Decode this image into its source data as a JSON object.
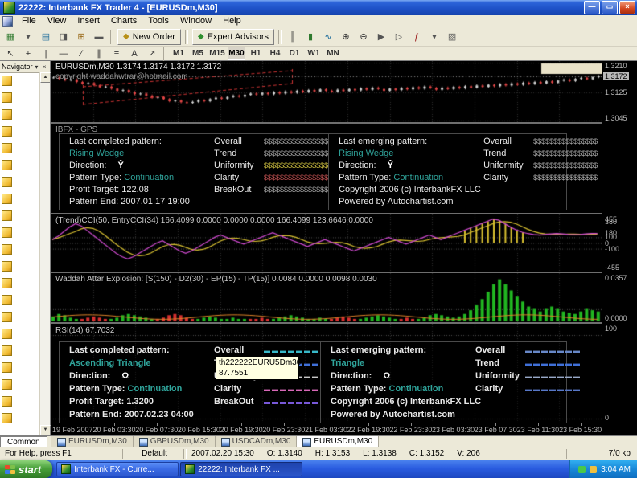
{
  "window": {
    "title": "22222: Interbank FX Trader 4 - [EURUSDm,M30]",
    "buttons": [
      {
        "name": "minimize-button",
        "glyph": "—"
      },
      {
        "name": "restore-button",
        "glyph": "▭"
      },
      {
        "name": "close-button",
        "glyph": "×"
      }
    ]
  },
  "menu": {
    "items": [
      "File",
      "View",
      "Insert",
      "Charts",
      "Tools",
      "Window",
      "Help"
    ]
  },
  "toolbar1": {
    "icons_a": [
      {
        "name": "new-chart-icon",
        "glyph": "▦",
        "color": "#2f7a2f"
      },
      {
        "name": "profiles-icon",
        "glyph": "▾",
        "color": "#555555"
      },
      {
        "name": "market-watch-icon",
        "glyph": "▤",
        "color": "#1a6a9a"
      },
      {
        "name": "data-window-icon",
        "glyph": "◨",
        "color": "#555555"
      },
      {
        "name": "navigator-icon",
        "glyph": "⊞",
        "color": "#9a6a1a"
      },
      {
        "name": "terminal-icon",
        "glyph": "▬",
        "color": "#555555"
      }
    ],
    "new_order": {
      "label": "New Order",
      "icon_glyph": "◆",
      "icon_color": "#b89018"
    },
    "expert_advisors": {
      "label": "Expert Advisors",
      "icon_glyph": "◆",
      "icon_color": "#2f8f2f"
    },
    "icons_b": [
      {
        "name": "bar-chart-icon",
        "glyph": "║",
        "color": "#333333"
      },
      {
        "name": "candlestick-icon",
        "glyph": "▮",
        "color": "#2f7a2f"
      },
      {
        "name": "line-chart-icon",
        "glyph": "∿",
        "color": "#1a6a9a"
      },
      {
        "name": "zoom-in-icon",
        "glyph": "⊕",
        "color": "#333333"
      },
      {
        "name": "zoom-out-icon",
        "glyph": "⊖",
        "color": "#333333"
      },
      {
        "name": "auto-scroll-icon",
        "glyph": "▶",
        "color": "#555555"
      },
      {
        "name": "chart-shift-icon",
        "glyph": "▷",
        "color": "#555555"
      },
      {
        "name": "indicators-icon",
        "glyph": "ƒ",
        "color": "#9a1a1a"
      },
      {
        "name": "periods-icon",
        "glyph": "▾",
        "color": "#555555"
      },
      {
        "name": "templates-icon",
        "glyph": "▧",
        "color": "#555555"
      }
    ]
  },
  "toolbar2": {
    "tools": [
      {
        "name": "cursor-icon",
        "glyph": "↖"
      },
      {
        "name": "crosshair-icon",
        "glyph": "+"
      },
      {
        "name": "vertical-line-icon",
        "glyph": "|"
      },
      {
        "name": "horizontal-line-icon",
        "glyph": "—"
      },
      {
        "name": "trendline-icon",
        "glyph": "∕"
      },
      {
        "name": "channel-icon",
        "glyph": "∥"
      },
      {
        "name": "fibonacci-icon",
        "glyph": "≡"
      },
      {
        "name": "text-icon",
        "glyph": "A"
      },
      {
        "name": "arrows-icon",
        "glyph": "↗"
      }
    ],
    "timeframes": [
      {
        "label": "M1",
        "active": false
      },
      {
        "label": "M5",
        "active": false
      },
      {
        "label": "M15",
        "active": false
      },
      {
        "label": "M30",
        "active": true
      },
      {
        "label": "H1",
        "active": false
      },
      {
        "label": "H4",
        "active": false
      },
      {
        "label": "D1",
        "active": false
      },
      {
        "label": "W1",
        "active": false
      },
      {
        "label": "MN",
        "active": false
      }
    ]
  },
  "navigator": {
    "title": "Navigator",
    "icon_count": 21,
    "common_tab": "Common"
  },
  "chart": {
    "info_line": "EURUSDm,M30 1.3174 1.3174 1.3172 1.3172",
    "copyright_line": "copyright waddahwtrar@hotmail.com"
  },
  "gps": {
    "panel_label": "IBFX - GPS",
    "left": {
      "header": "Last completed pattern:",
      "pattern": "Rising Wedge",
      "direction_label": "Direction:",
      "direction_symbol": "Ŷ",
      "type_label": "Pattern Type:",
      "type_value": "Continuation",
      "target_label": "Profit Target:",
      "target_value": "122.08",
      "end_label": "Pattern End:",
      "end_value": "2007.01.17 19:00"
    },
    "left_ratings": [
      {
        "label": "Overall",
        "value": "$$$$$$$$$$$$$$$$",
        "color": "#a8a8a8"
      },
      {
        "label": "Trend",
        "value": "$$$$$$$$$$$$$$$$",
        "color": "#a8a8a8"
      },
      {
        "label": "Uniformity",
        "value": "$$$$$$$$$$$$$$$$",
        "color": "#cfc040"
      },
      {
        "label": "Clarity",
        "value": "$$$$$$$$$$$$$$$$",
        "color": "#c05050"
      },
      {
        "label": "BreakOut",
        "value": "$$$$$$$$$$$$$$$$",
        "color": "#a8a8a8"
      }
    ],
    "right": {
      "header": "Last emerging pattern:",
      "pattern": "Rising Wedge",
      "direction_label": "Direction:",
      "direction_symbol": "Ŷ",
      "type_label": "Pattern Type:",
      "type_value": "Continuation"
    },
    "right_ratings": [
      {
        "label": "Overall",
        "value": "$$$$$$$$$$$$$$$$",
        "color": "#a8a8a8"
      },
      {
        "label": "Trend",
        "value": "$$$$$$$$$$$$$$$$",
        "color": "#a8a8a8"
      },
      {
        "label": "Uniformity",
        "value": "$$$$$$$$$$$$$$$$",
        "color": "#a8a8a8"
      },
      {
        "label": "Clarity",
        "value": "$$$$$$$$$$$$$$$$",
        "color": "#a8a8a8"
      }
    ],
    "copyright1": "Copyright 2006 (c) InterbankFX LLC",
    "copyright2": "Powered by Autochartist.com"
  },
  "cci": {
    "label": "(Trend)CCI(50, EntryCCI(34) 166.4099 0.0000 0.0000 0.0000 166.4099 123.6646 0.0000"
  },
  "waddah": {
    "label": "Waddah Attar Explosion: [S(150) - D2(30) - EP(15) - TP(15)] 0.0084 0.0000 0.0098 0.0030"
  },
  "rsi": {
    "label": "RSI(14) 67.7032",
    "left": {
      "header": "Last completed pattern:",
      "pattern": "Ascending Triangle",
      "direction_label": "Direction:",
      "direction_symbol": "Ω",
      "type_label": "Pattern Type:",
      "type_value": "Continuation",
      "target_label": "Profit Target:",
      "target_value": "1.3200",
      "end_label": "Pattern End:",
      "end_value": "2007.02.23 04:00"
    },
    "left_ratings": [
      {
        "label": "Overall",
        "value": "▬▬▬▬▬▬▬",
        "color": "#38b8c8"
      },
      {
        "label": "Trend",
        "value": "▬▬▬▬▬▬▬",
        "color": "#4070d8"
      },
      {
        "label": "Uniformity",
        "value": "▬▬▬▬▬▬▬",
        "color": "#c8c8c8"
      },
      {
        "label": "Clarity",
        "value": "▬▬▬▬▬▬▬",
        "color": "#d868b8"
      },
      {
        "label": "BreakOut",
        "value": "▬▬▬▬▬▬▬",
        "color": "#7858d8"
      }
    ],
    "tooltip": {
      "line1": "th222222EURU5Dm30",
      "line2": "87.7551"
    },
    "right": {
      "header": "Last emerging pattern:",
      "pattern": "Triangle",
      "direction_label": "Direction:",
      "direction_symbol": "Ω",
      "type_label": "Pattern Type:",
      "type_value": "Continuation"
    },
    "right_ratings": [
      {
        "label": "Overall",
        "value": "▬▬▬▬▬▬▬",
        "color": "#6888c8"
      },
      {
        "label": "Trend",
        "value": "▬▬▬▬▬▬▬",
        "color": "#4070d8"
      },
      {
        "label": "Uniformity",
        "value": "▬▬▬▬▬▬▬",
        "color": "#98a8c8"
      },
      {
        "label": "Clarity",
        "value": "▬▬▬▬▬▬▬",
        "color": "#5878c8"
      }
    ],
    "copyright1": "Copyright 2006 (c) InterbankFX LLC",
    "copyright2": "Powered by Autochartist.com"
  },
  "time_axis": {
    "labels": [
      "19 Feb 2007",
      "20 Feb 03:30",
      "20 Feb 07:30",
      "20 Feb 15:30",
      "20 Feb 19:30",
      "20 Feb 23:30",
      "21 Feb 03:30",
      "22 Feb 19:30",
      "22 Feb 23:30",
      "23 Feb 03:30",
      "23 Feb 07:30",
      "23 Feb 11:30",
      "23 Feb 15:30"
    ]
  },
  "tabs": {
    "items": [
      {
        "label": "EURUSDm,M30",
        "active": false
      },
      {
        "label": "GBPUSDm,M30",
        "active": false
      },
      {
        "label": "USDCADm,M30",
        "active": false
      },
      {
        "label": "EURUSDm,M30",
        "active": true
      }
    ]
  },
  "status": {
    "help": "For Help, press F1",
    "profile": "Default",
    "time": "2007.02.20 15:30",
    "fields": [
      {
        "label": "O:",
        "value": "1.3140"
      },
      {
        "label": "H:",
        "value": "1.3153"
      },
      {
        "label": "L:",
        "value": "1.3138"
      },
      {
        "label": "C:",
        "value": "1.3152"
      },
      {
        "label": "V:",
        "value": "206"
      }
    ],
    "kb": "7/0 kb"
  },
  "taskbar": {
    "start": "start",
    "tasks": [
      {
        "label": "Interbank FX - Curre...",
        "active": false
      },
      {
        "label": "22222: Interbank FX ...",
        "active": true
      }
    ],
    "tray_time": "3:04 AM"
  },
  "charts": {
    "main": {
      "type": "candlestick",
      "ymin": 13040,
      "ymax": 13215,
      "current": 13172,
      "scale": [
        {
          "v": 13210,
          "t": "1.3210"
        },
        {
          "v": 13172,
          "t": "1.3172",
          "boxed": true
        },
        {
          "v": 13125,
          "t": "1.3125"
        },
        {
          "v": 13045,
          "t": "1.3045"
        }
      ],
      "closes": [
        13168,
        13164,
        13160,
        13162,
        13155,
        13150,
        13152,
        13146,
        13140,
        13142,
        13136,
        13130,
        13132,
        13126,
        13120,
        13122,
        13116,
        13110,
        13112,
        13106,
        13100,
        13102,
        13097,
        13095,
        13098,
        13103,
        13100,
        13106,
        13110,
        13107,
        13112,
        13116,
        13113,
        13118,
        13122,
        13119,
        13124,
        13120,
        13126,
        13122,
        13128,
        13124,
        13130,
        13126,
        13132,
        13128,
        13134,
        13130,
        13127,
        13133,
        13129,
        13135,
        13131,
        13137,
        13133,
        13139,
        13135,
        13130,
        13136,
        13132,
        13138,
        13134,
        13140,
        13136,
        13142,
        13138,
        13133,
        13139,
        13135,
        13141,
        13137,
        13143,
        13139,
        13145,
        13141,
        13147,
        13143,
        13149,
        13145,
        13151,
        13147,
        13153,
        13149,
        13155,
        13151,
        13157,
        13153,
        13159,
        13162,
        13158,
        13164,
        13167,
        13163,
        13169,
        13172
      ]
    },
    "cci": {
      "type": "line",
      "ymin": -500,
      "ymax": 500,
      "scale": [
        {
          "v": 455,
          "t": "455"
        },
        {
          "v": 380,
          "t": "380"
        },
        {
          "v": 180,
          "t": "180"
        },
        {
          "v": 100,
          "t": "100"
        },
        {
          "v": 0,
          "t": "0"
        },
        {
          "v": -100,
          "t": "-100"
        },
        {
          "v": -455,
          "t": "-455"
        }
      ],
      "values": [
        60,
        120,
        200,
        280,
        340,
        300,
        220,
        140,
        60,
        -20,
        -100,
        -180,
        -240,
        -280,
        -240,
        -180,
        -120,
        -60,
        0,
        40,
        -20,
        -80,
        -140,
        -180,
        -140,
        -80,
        -20,
        40,
        100,
        140,
        100,
        60,
        20,
        -20,
        20,
        60,
        100,
        140,
        180,
        140,
        100,
        60,
        20,
        -20,
        -60,
        -20,
        20,
        60,
        20,
        -20,
        -60,
        -100,
        -140,
        -100,
        -60,
        -20,
        20,
        60,
        100,
        60,
        20,
        -20,
        20,
        60,
        100,
        140,
        100,
        60,
        100,
        140,
        180,
        220,
        260,
        300,
        340,
        380,
        420,
        400,
        340,
        280,
        230,
        190,
        166,
        150,
        140,
        150,
        160,
        166,
        160,
        150,
        145,
        150,
        160,
        166,
        166
      ]
    },
    "waddah": {
      "type": "bar",
      "ymax": 357,
      "scale": [
        {
          "v": 357,
          "t": "0.0357"
        },
        {
          "v": 0,
          "t": "0.0000"
        }
      ],
      "values": [
        40,
        60,
        50,
        30,
        20,
        -20,
        -30,
        -40,
        -30,
        -20,
        20,
        30,
        50,
        60,
        50,
        40,
        30,
        20,
        -20,
        -30,
        -50,
        -60,
        -50,
        -30,
        -20,
        20,
        30,
        40,
        30,
        20,
        20,
        30,
        20,
        20,
        -20,
        -20,
        -30,
        -20,
        20,
        30,
        40,
        50,
        40,
        30,
        20,
        20,
        30,
        20,
        -20,
        -30,
        -40,
        -30,
        -20,
        20,
        30,
        40,
        50,
        40,
        30,
        20,
        -20,
        -30,
        -20,
        20,
        30,
        50,
        60,
        50,
        40,
        30,
        40,
        60,
        90,
        130,
        180,
        240,
        300,
        340,
        300,
        250,
        200,
        160,
        120,
        100,
        80,
        100,
        120,
        100,
        80,
        70,
        60,
        80,
        100,
        90,
        80
      ]
    },
    "rsi": {
      "type": "line",
      "ymin": 0,
      "ymax": 100,
      "scale": [
        {
          "v": 97,
          "t": "100"
        },
        {
          "v": 6,
          "t": "0"
        }
      ]
    }
  }
}
